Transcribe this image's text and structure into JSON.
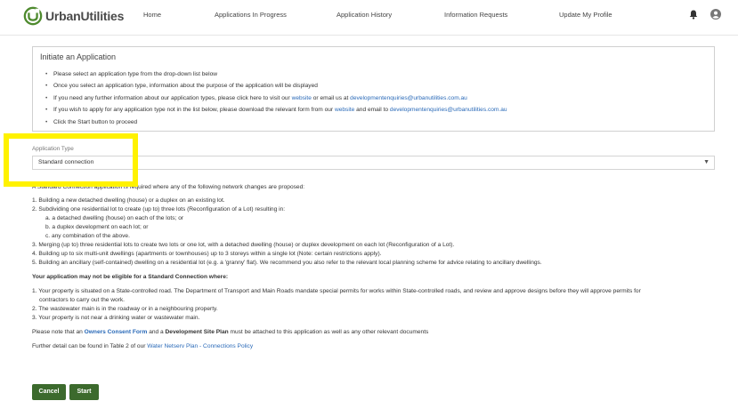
{
  "brand": {
    "name": "UrbanUtilities",
    "color": "#4e8a2e"
  },
  "nav": {
    "home": "Home",
    "progress": "Applications In Progress",
    "history": "Application History",
    "requests": "Information Requests",
    "profile": "Update My Profile"
  },
  "panel": {
    "title": "Initiate an Application",
    "b1": "Please select an application type from the drop-down list below",
    "b2": "Once you select an application type, information about the purpose of the application will be displayed",
    "b3_pre": "If you need any further information about our application types, please click here to visit our ",
    "b3_link": "website",
    "b3_mid": " or email us at ",
    "b3_email": "developmentenquiries@urbanutilities.com.au",
    "b4_pre": "If you wish to apply for any application type not in the list below, please download the relevant form from our ",
    "b4_link": "website",
    "b4_mid": " and email to ",
    "b4_email": "developmentenquiries@urbanutilities.com.au",
    "b5": "Click the Start button to proceed"
  },
  "field": {
    "label": "Application Type",
    "value": "Standard connection"
  },
  "content": {
    "intro": "A Standard Connection application is required where any of the following network changes are proposed:",
    "l1": "1. Building a new detached dwelling (house) or a duplex on an existing lot.",
    "l2": "2. Subdividing one residential lot to create (up to) three lots (Reconfiguration of a Lot) resulting in:",
    "l2a": "a. a detached dwelling (house) on each of the lots; or",
    "l2b": "b. a duplex development on each lot; or",
    "l2c": "c. any combination of the above.",
    "l3": "3. Merging (up to) three residential lots to create two lots or one lot, with a detached dwelling (house) or duplex development on each lot (Reconfiguration of a Lot).",
    "l4": "4. Building up to six multi-unit dwellings (apartments or townhouses) up to 3 storeys within a single lot (Note: certain restrictions apply).",
    "l5": "5. Building an ancillary (self-contained) dwelling on a residential lot (e.g. a 'granny' flat). We recommend you also refer to the relevant local planning scheme for advice relating to ancillary dwellings.",
    "not_eligible": "Your application may not be eligible for a Standard Connection where:",
    "n1a": "1. Your property is situated on a State-controlled road. The Department of Transport and Main Roads mandate special permits for works within State-controlled roads, and review and approve designs before they will approve permits for",
    "n1b": "contractors to carry out the work.",
    "n2": "2. The wastewater main is in the roadway or in a neighbouring property.",
    "n3": "3. Your property is not near a drinking water or wastewater main.",
    "note_pre": "Please note that an ",
    "note_b1": "Owners Consent Form",
    "note_mid": " and a ",
    "note_b2": "Development Site Plan",
    "note_post": " must be attached to this application as well as any other relevant documents",
    "further_pre": "Further detail can be found in Table 2 of our ",
    "further_link": "Water Netserv Plan - Connections Policy"
  },
  "buttons": {
    "cancel": "Cancel",
    "start": "Start"
  },
  "colors": {
    "button": "#3c6a2d",
    "link": "#2a6ab8",
    "highlight": "#fff200"
  }
}
